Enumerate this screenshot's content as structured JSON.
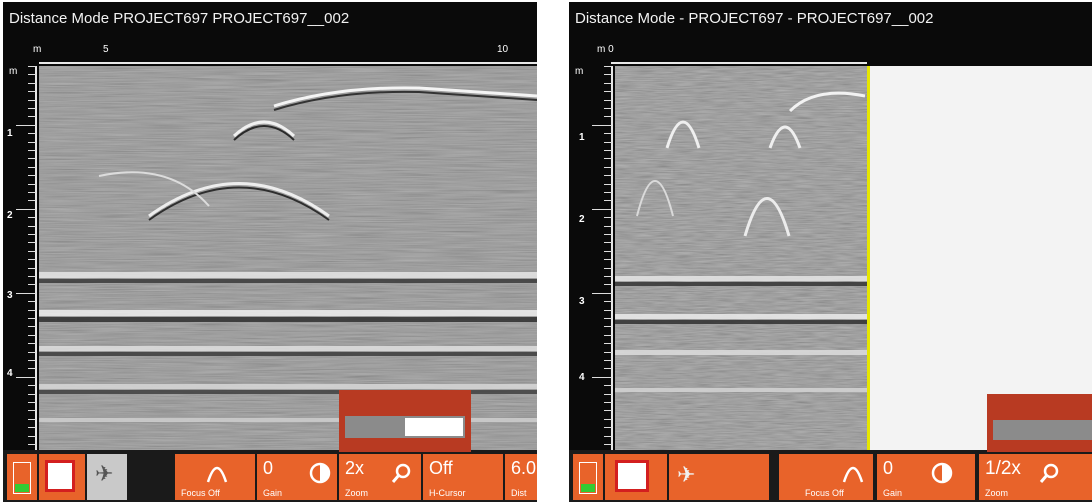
{
  "left": {
    "title": "Distance Mode   PROJECT697   PROJECT697__002",
    "x_unit": "m",
    "x_ticks": [
      "5",
      "10"
    ],
    "y_unit": "m",
    "y_ticks": [
      "1",
      "2",
      "3",
      "4"
    ],
    "toolbar": {
      "battery_label": "",
      "focus_label": "Focus Off",
      "gain_value": "0",
      "gain_label": "Gain",
      "zoom_value": "2x",
      "zoom_label": "Zoom",
      "hcursor_value": "Off",
      "hcursor_label": "H-Cursor",
      "dist_value": "6.0",
      "dist_label": "Dist"
    },
    "zoom_slider_level": 0.4
  },
  "right": {
    "title": "Distance Mode - PROJECT697 - PROJECT697__002",
    "x_unit": "m 0",
    "y_unit": "m",
    "y_ticks": [
      "1",
      "2",
      "3",
      "4"
    ],
    "toolbar": {
      "focus_label": "Focus Off",
      "gain_value": "0",
      "gain_label": "Gain",
      "zoom_value": "1/2x",
      "zoom_label": "Zoom"
    }
  },
  "colors": {
    "toolbar_orange": "#e8632a",
    "popup_red": "#b83a22",
    "end_marker_yellow": "#e6e600"
  }
}
